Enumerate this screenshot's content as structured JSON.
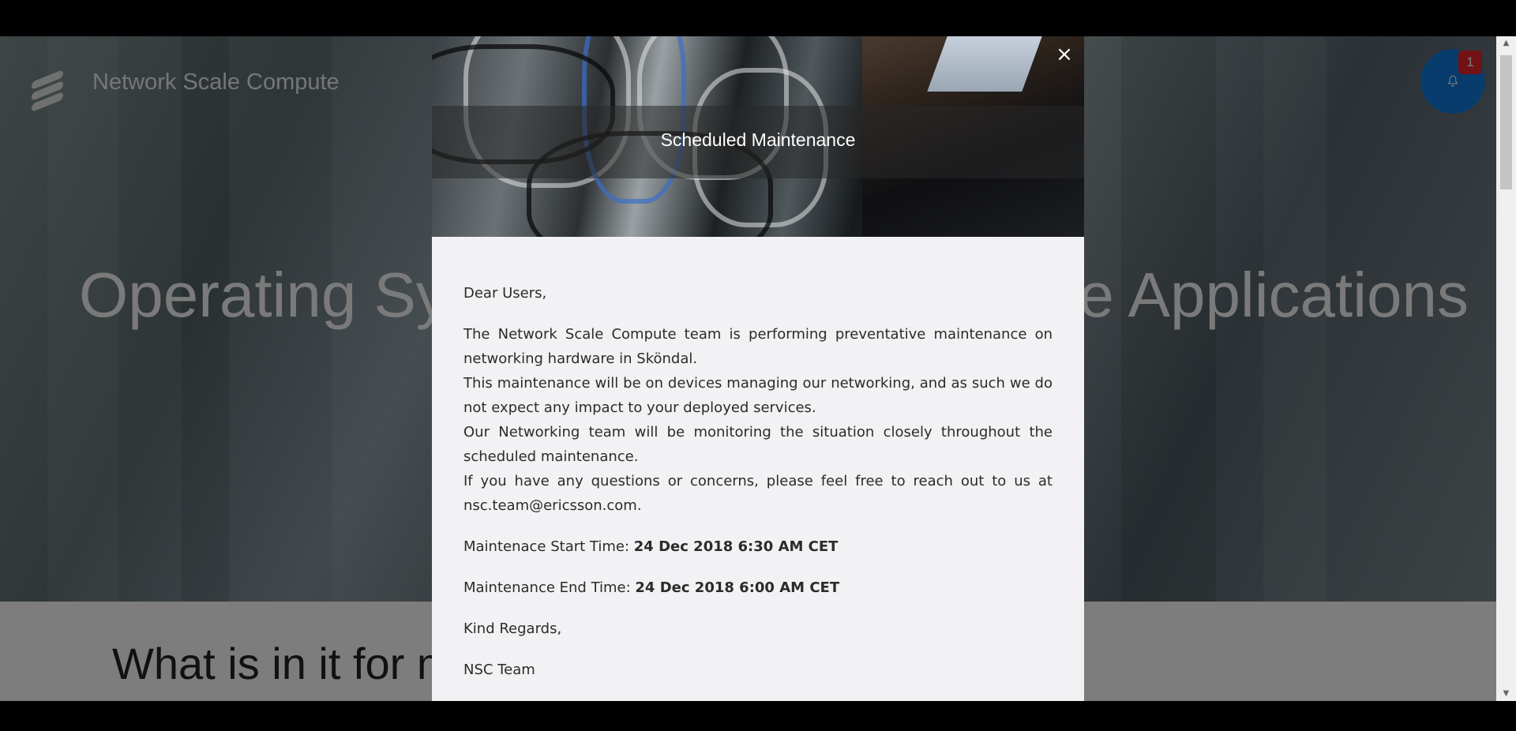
{
  "app": {
    "title": "Network Scale Compute"
  },
  "hero": {
    "heading_left": "Operating Sy",
    "heading_right": "e Applications"
  },
  "section": {
    "heading": "What is in it for m"
  },
  "notifications": {
    "count": "1",
    "icon": "bell-icon",
    "color": "#0f79d9",
    "badge_color": "#e4252b"
  },
  "modal": {
    "title": "Scheduled Maintenance",
    "close_label": "×",
    "greeting": "Dear Users,",
    "paragraphs": [
      "The Network Scale Compute team is performing preventative maintenance on networking hardware in Sköndal.",
      "This maintenance will be on devices managing our networking, and as such we do not expect any impact to your deployed services.",
      "Our Networking team will be monitoring the situation closely throughout the scheduled maintenance.",
      "If you have any questions or concerns, please feel free to reach out to us at nsc.team@ericsson.com."
    ],
    "start_label": "Maintenace Start Time: ",
    "start_value": "24 Dec 2018 6:30 AM CET",
    "end_label": "Maintenance End Time: ",
    "end_value": "24 Dec 2018 6:00 AM CET",
    "closing": "Kind Regards,",
    "signature": "NSC Team"
  },
  "scrollbar": {
    "up_icon": "▲",
    "down_icon": "▼"
  }
}
